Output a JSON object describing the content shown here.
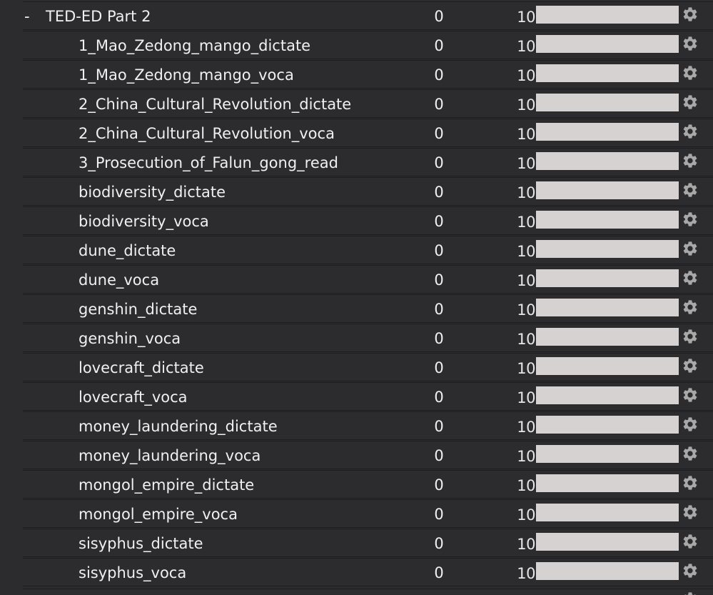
{
  "deck_group": {
    "collapse_symbol": "-",
    "title": "TED-ED Part 2",
    "new_count": "0",
    "due_count": "10",
    "progress": 0,
    "bar_color": "#d6d2d2",
    "gear_icon": "gear-icon"
  },
  "decks": [
    {
      "name": "1_Mao_Zedong_mango_dictate",
      "new_count": "0",
      "due_count": "10",
      "progress": 0
    },
    {
      "name": "1_Mao_Zedong_mango_voca",
      "new_count": "0",
      "due_count": "10",
      "progress": 0
    },
    {
      "name": "2_China_Cultural_Revolution_dictate",
      "new_count": "0",
      "due_count": "10",
      "progress": 0
    },
    {
      "name": "2_China_Cultural_Revolution_voca",
      "new_count": "0",
      "due_count": "10",
      "progress": 0
    },
    {
      "name": "3_Prosecution_of_Falun_gong_read",
      "new_count": "0",
      "due_count": "10",
      "progress": 0
    },
    {
      "name": "biodiversity_dictate",
      "new_count": "0",
      "due_count": "10",
      "progress": 0
    },
    {
      "name": "biodiversity_voca",
      "new_count": "0",
      "due_count": "10",
      "progress": 0
    },
    {
      "name": "dune_dictate",
      "new_count": "0",
      "due_count": "10",
      "progress": 0
    },
    {
      "name": "dune_voca",
      "new_count": "0",
      "due_count": "10",
      "progress": 0
    },
    {
      "name": "genshin_dictate",
      "new_count": "0",
      "due_count": "10",
      "progress": 0
    },
    {
      "name": "genshin_voca",
      "new_count": "0",
      "due_count": "10",
      "progress": 0
    },
    {
      "name": "lovecraft_dictate",
      "new_count": "0",
      "due_count": "10",
      "progress": 0
    },
    {
      "name": "lovecraft_voca",
      "new_count": "0",
      "due_count": "10",
      "progress": 0
    },
    {
      "name": "money_laundering_dictate",
      "new_count": "0",
      "due_count": "10",
      "progress": 0
    },
    {
      "name": "money_laundering_voca",
      "new_count": "0",
      "due_count": "10",
      "progress": 0
    },
    {
      "name": "mongol_empire_dictate",
      "new_count": "0",
      "due_count": "10",
      "progress": 0
    },
    {
      "name": "mongol_empire_voca",
      "new_count": "0",
      "due_count": "10",
      "progress": 0
    },
    {
      "name": "sisyphus_dictate",
      "new_count": "0",
      "due_count": "10",
      "progress": 0
    },
    {
      "name": "sisyphus_voca",
      "new_count": "0",
      "due_count": "10",
      "progress": 0
    }
  ],
  "colors": {
    "background": "#2c2c2e",
    "row_border": "#1d1d1f",
    "text": "#f0f0f0",
    "gear": "#a8a8a8"
  }
}
